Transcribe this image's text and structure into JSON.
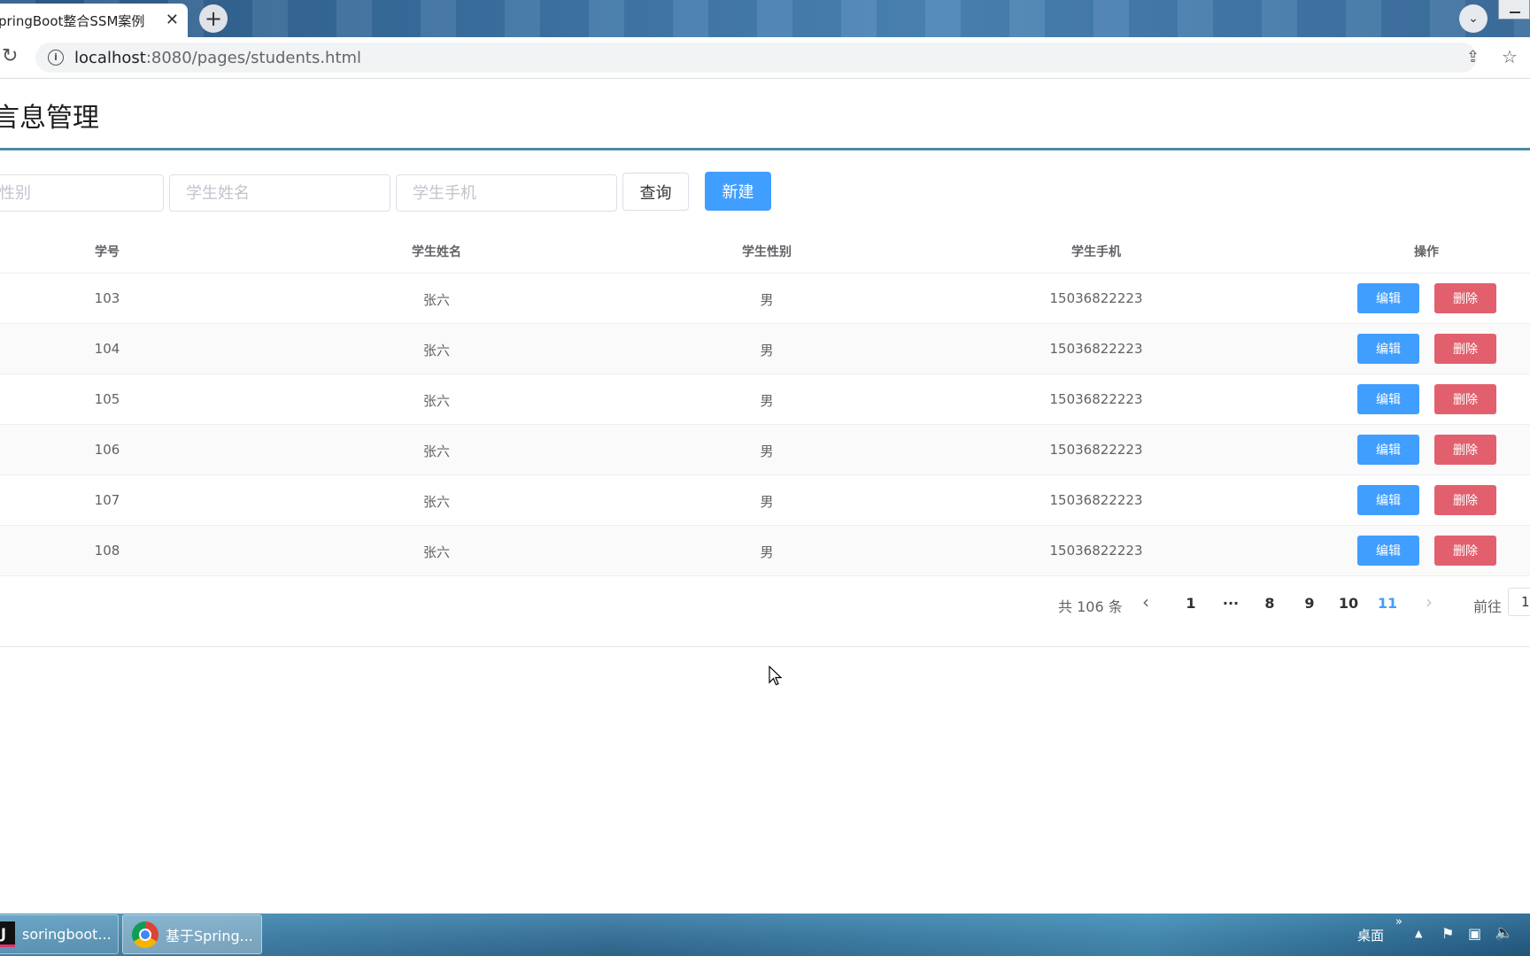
{
  "browser": {
    "tab_title": "pringBoot整合SSM案例",
    "tab_close": "✕",
    "new_tab": "+",
    "tab_menu": "⌄",
    "url_host": "localhost",
    "url_rest": ":8080/pages/students.html"
  },
  "page": {
    "title": "言息管理"
  },
  "filters": {
    "gender_placeholder": "性别",
    "name_placeholder": "学生姓名",
    "phone_placeholder": "学生手机",
    "query_label": "查询",
    "new_label": "新建"
  },
  "table": {
    "headers": [
      "学号",
      "学生姓名",
      "学生性别",
      "学生手机",
      "操作"
    ],
    "rows": [
      {
        "id": "103",
        "name": "张六",
        "gender": "男",
        "phone": "15036822223"
      },
      {
        "id": "104",
        "name": "张六",
        "gender": "男",
        "phone": "15036822223"
      },
      {
        "id": "105",
        "name": "张六",
        "gender": "男",
        "phone": "15036822223"
      },
      {
        "id": "106",
        "name": "张六",
        "gender": "男",
        "phone": "15036822223"
      },
      {
        "id": "107",
        "name": "张六",
        "gender": "男",
        "phone": "15036822223"
      },
      {
        "id": "108",
        "name": "张六",
        "gender": "男",
        "phone": "15036822223"
      }
    ],
    "edit_label": "编辑",
    "delete_label": "删除"
  },
  "pagination": {
    "total_text": "共 106 条",
    "prev": "‹",
    "pages": [
      "1",
      "···",
      "8",
      "9",
      "10",
      "11"
    ],
    "current": "11",
    "next": "›",
    "goto_label": "前往",
    "goto_value": "1"
  },
  "taskbar": {
    "items": [
      "soringboot...",
      "基于Spring..."
    ],
    "desktop_label": "桌面",
    "tray_chevron": "»",
    "tray_up": "▲"
  },
  "colors": {
    "primary": "#409eff",
    "danger": "#e2606d",
    "header_line": "#4f89a6"
  }
}
